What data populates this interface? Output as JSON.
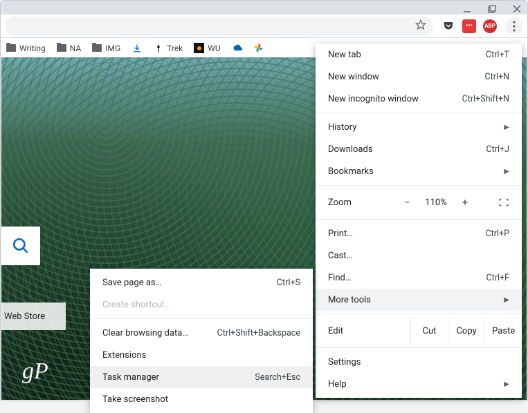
{
  "window_controls": {
    "minimize": "minimize",
    "maximize": "maximize",
    "close": "close"
  },
  "toolbar": {
    "star": "bookmark-star"
  },
  "extensions": {
    "pocket_glyph": "⌄",
    "red_label": "•••",
    "abp_label": "ABP"
  },
  "bookmarks": {
    "items": [
      {
        "label": "Writing",
        "type": "folder"
      },
      {
        "label": "NA",
        "type": "folder"
      },
      {
        "label": "IMG",
        "type": "folder"
      },
      {
        "label": "",
        "type": "download"
      },
      {
        "label": "Trek",
        "type": "trek"
      },
      {
        "label": "WU",
        "type": "wu"
      },
      {
        "label": "",
        "type": "onedrive"
      },
      {
        "label": "",
        "type": "photos"
      }
    ]
  },
  "tiles": {
    "webstore_label": "Web Store"
  },
  "watermark": "gP",
  "menu": {
    "new_tab": {
      "label": "New tab",
      "shortcut": "Ctrl+T"
    },
    "new_window": {
      "label": "New window",
      "shortcut": "Ctrl+N"
    },
    "incognito": {
      "label": "New incognito window",
      "shortcut": "Ctrl+Shift+N"
    },
    "history": {
      "label": "History"
    },
    "downloads": {
      "label": "Downloads",
      "shortcut": "Ctrl+J"
    },
    "bookmarks": {
      "label": "Bookmarks"
    },
    "zoom": {
      "label": "Zoom",
      "minus": "−",
      "value": "110%",
      "plus": "+"
    },
    "print": {
      "label": "Print…",
      "shortcut": "Ctrl+P"
    },
    "cast": {
      "label": "Cast…"
    },
    "find": {
      "label": "Find…",
      "shortcut": "Ctrl+F"
    },
    "more_tools": {
      "label": "More tools"
    },
    "edit": {
      "label": "Edit",
      "cut": "Cut",
      "copy": "Copy",
      "paste": "Paste"
    },
    "settings": {
      "label": "Settings"
    },
    "help": {
      "label": "Help"
    }
  },
  "submenu": {
    "save_page": {
      "label": "Save page as…",
      "shortcut": "Ctrl+S"
    },
    "create_shortcut": {
      "label": "Create shortcut…"
    },
    "clear_data": {
      "label": "Clear browsing data…",
      "shortcut": "Ctrl+Shift+Backspace"
    },
    "extensions": {
      "label": "Extensions"
    },
    "task_manager": {
      "label": "Task manager",
      "shortcut": "Search+Esc"
    },
    "screenshot": {
      "label": "Take screenshot"
    }
  }
}
